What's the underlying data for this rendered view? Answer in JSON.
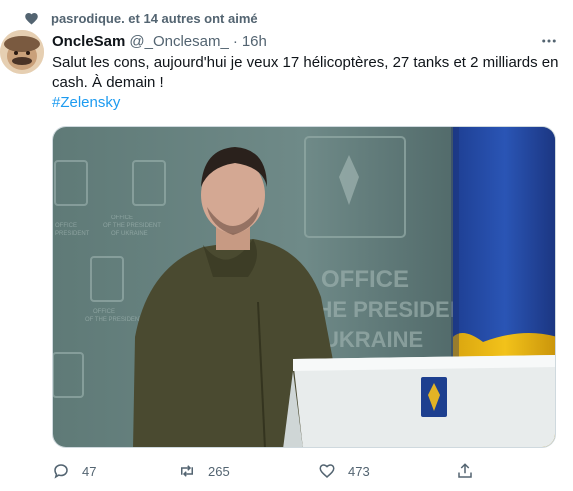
{
  "social_context": {
    "text": "pasrodique. et 14 autres ont aimé",
    "icon": "heart-icon"
  },
  "tweet": {
    "display_name": "OncleSam",
    "handle": "@_Onclesam_",
    "separator": "·",
    "time": "16h",
    "text": "Salut les cons, aujourd'hui je veux 17 hélicoptères, 27 tanks et 2 milliards en cash. À demain !",
    "hashtag": "#Zelensky"
  },
  "media": {
    "alt_signs": [
      "OFFICE",
      "THE PRESIDENT",
      "UKRAINE"
    ]
  },
  "actions": {
    "reply_count": "47",
    "retweet_count": "265",
    "like_count": "473"
  },
  "colors": {
    "accent": "#1d9bf0",
    "secondary_text": "#536471",
    "flag_blue": "#2a55b5",
    "flag_yellow": "#f2c21a"
  }
}
